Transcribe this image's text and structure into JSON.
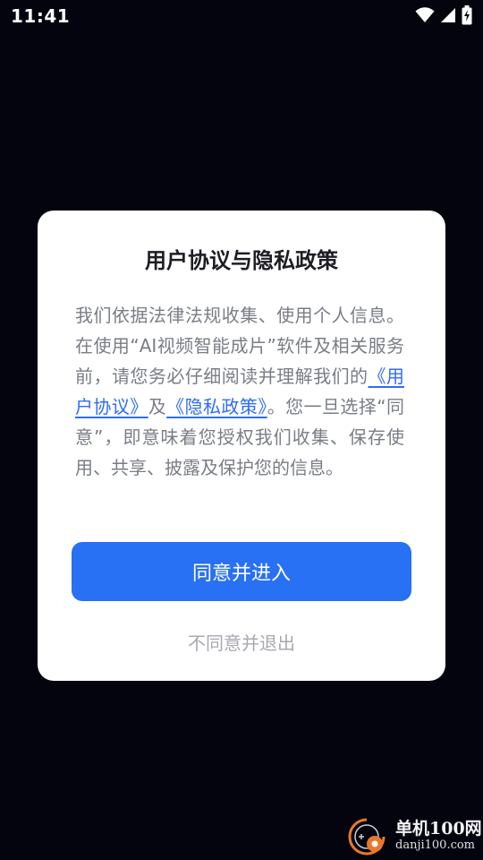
{
  "status_bar": {
    "time": "11:41",
    "icons": [
      "wifi-icon",
      "cellular-signal-icon",
      "battery-charging-icon"
    ]
  },
  "dialog": {
    "title": "用户协议与隐私政策",
    "body_text_1": "我们依据法律法规收集、使用个人信息。在使用“AI视频智能成片”软件及相关服务前，请您务必仔细阅读并理解我们的",
    "user_agreement_link": "《用户协议》",
    "conjunction": "及",
    "privacy_policy_link": "《隐私政策》",
    "body_text_2": "。您一旦选择“同意”，即意味着您授权我们收集、保存使用、共享、披露及保护您的信息。",
    "agree_button_label": "同意并进入",
    "disagree_button_label": "不同意并退出"
  },
  "watermark": {
    "title": "单机100网",
    "url": "danji100.com"
  },
  "colors": {
    "background": "#04040e",
    "dialog_background": "#ffffff",
    "primary_button": "#2870f4",
    "link": "#2f6cf6",
    "body_text": "#7a7d86",
    "secondary_text": "#a7a9b0",
    "title_text": "#1d1d24"
  }
}
